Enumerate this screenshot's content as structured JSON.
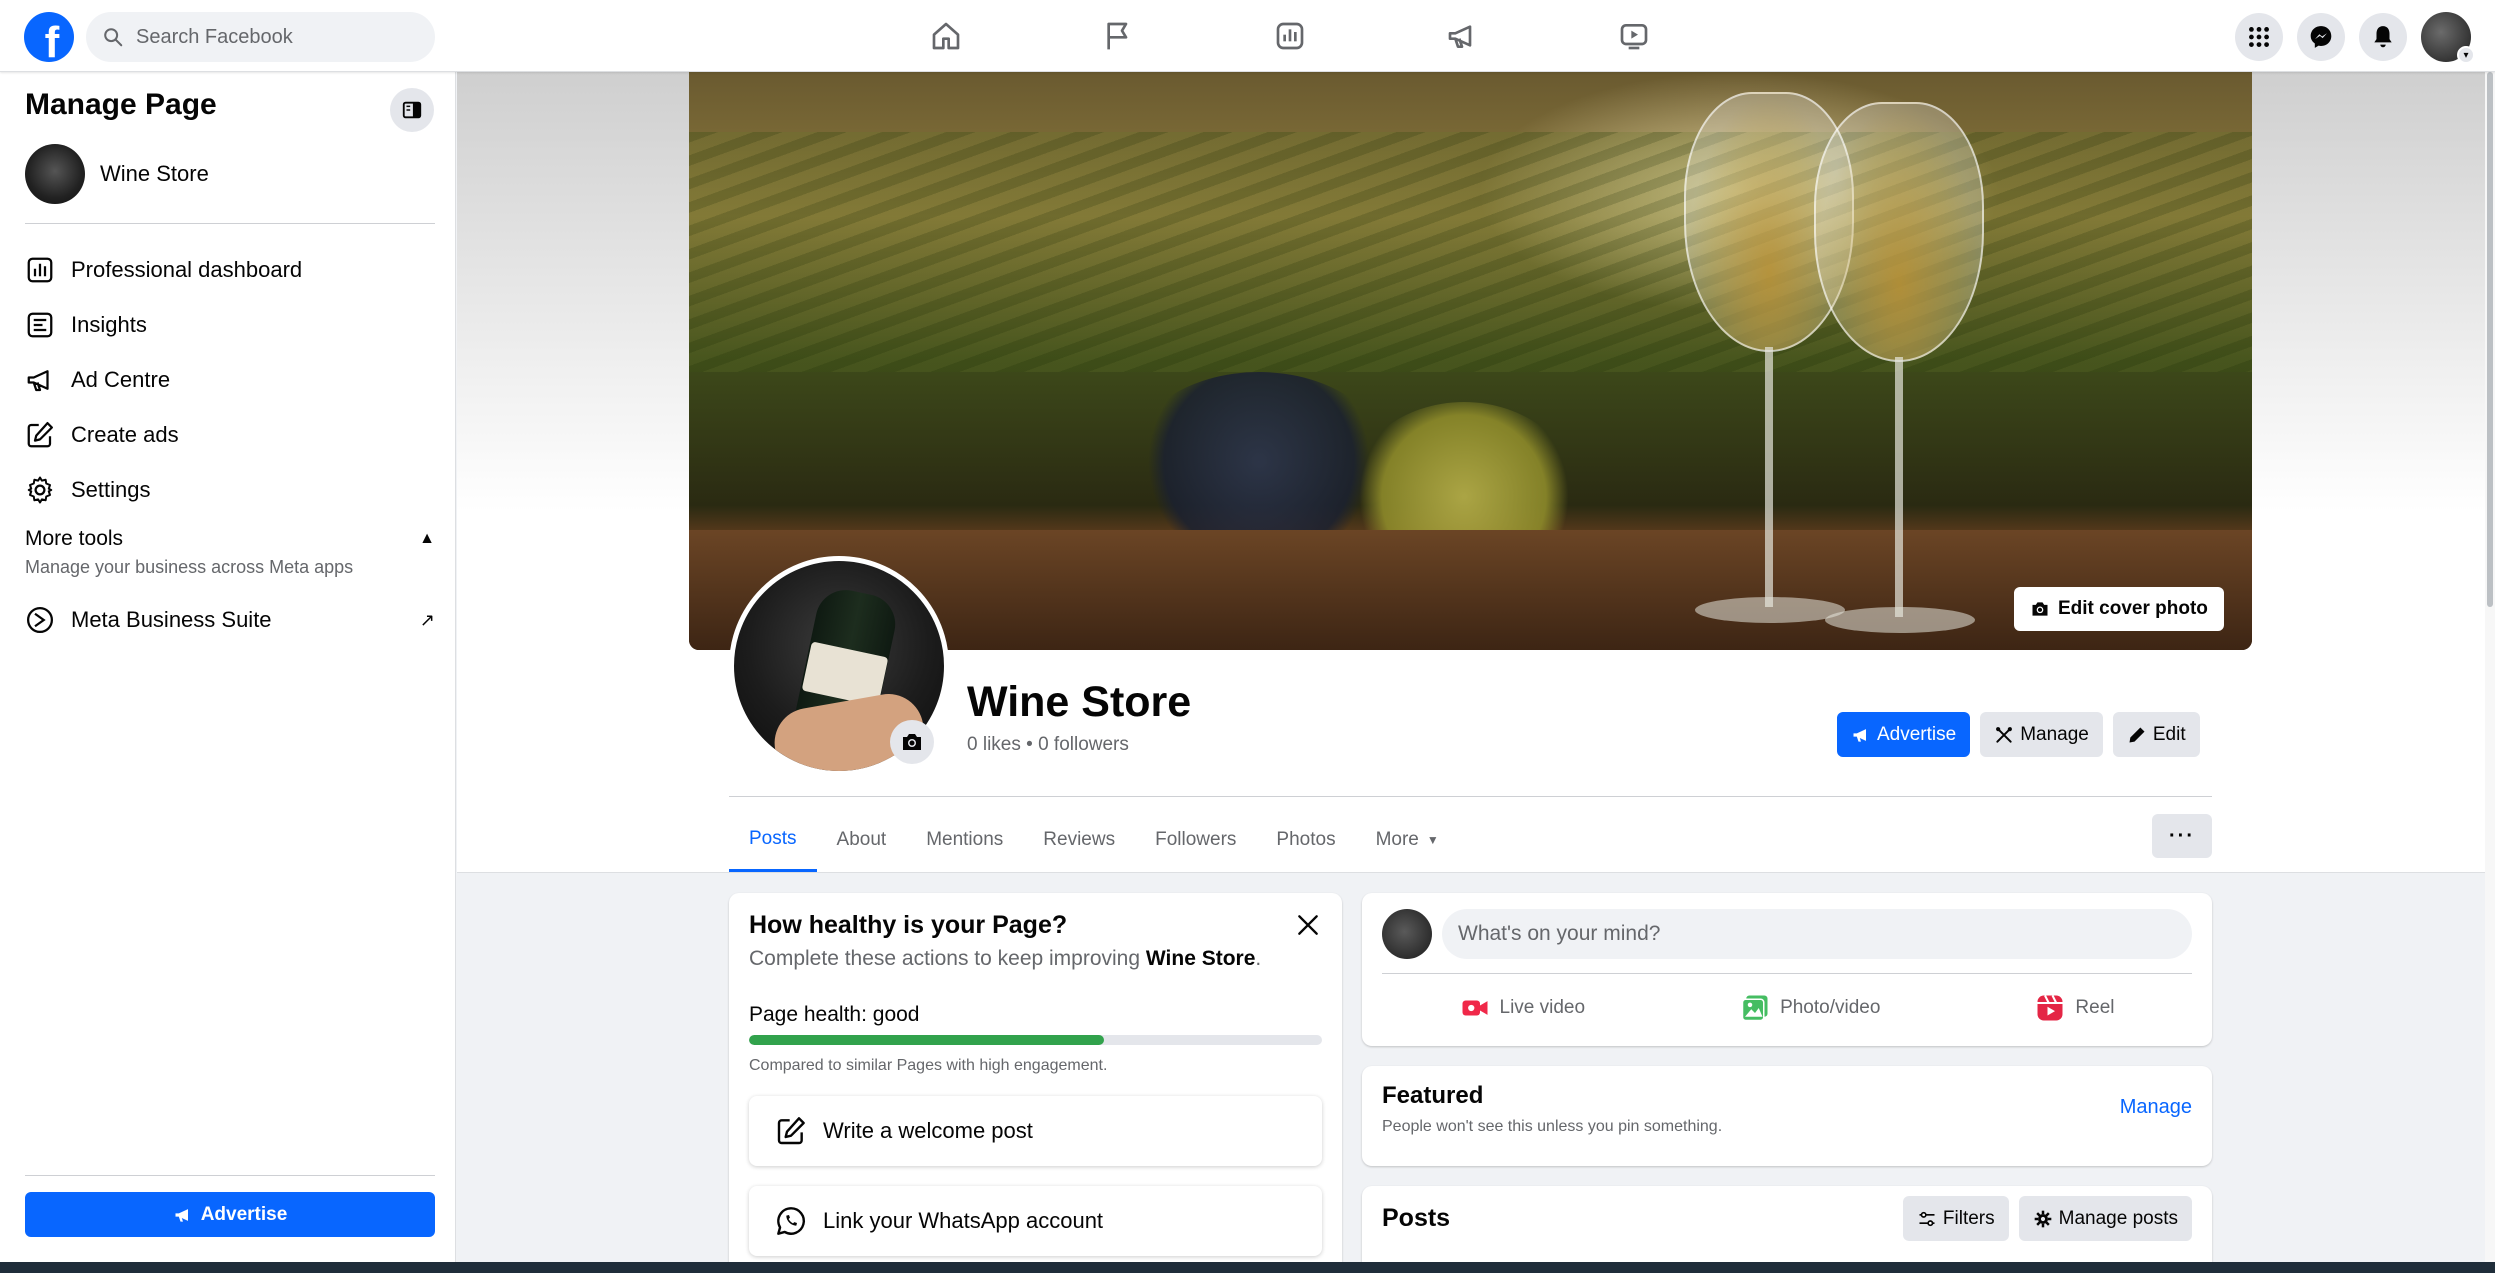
{
  "topbar": {
    "search_placeholder": "Search Facebook",
    "nav_icons": [
      "home-icon",
      "flag-icon",
      "dashboard-icon",
      "megaphone-icon",
      "video-icon"
    ],
    "right_icons": [
      "menu-grid-icon",
      "messenger-icon",
      "bell-icon"
    ]
  },
  "sidebar": {
    "title": "Manage Page",
    "page_name": "Wine Store",
    "items": [
      {
        "label": "Professional dashboard",
        "icon": "dashboard-icon"
      },
      {
        "label": "Insights",
        "icon": "insights-icon"
      },
      {
        "label": "Ad Centre",
        "icon": "megaphone-icon"
      },
      {
        "label": "Create ads",
        "icon": "pencil-square-icon"
      },
      {
        "label": "Settings",
        "icon": "gear-icon"
      }
    ],
    "more_tools": {
      "title": "More tools",
      "subtitle": "Manage your business across Meta apps"
    },
    "meta_business_suite": "Meta Business Suite",
    "advertise_label": "Advertise"
  },
  "header": {
    "edit_cover_label": "Edit cover photo",
    "page_title": "Wine Store",
    "stats": "0 likes • 0 followers",
    "actions": {
      "advertise": "Advertise",
      "manage": "Manage",
      "edit": "Edit"
    },
    "tabs": [
      "Posts",
      "About",
      "Mentions",
      "Reviews",
      "Followers",
      "Photos",
      "More"
    ],
    "active_tab": "Posts",
    "more_dots": "···"
  },
  "health_card": {
    "title": "How healthy is your Page?",
    "subtitle_prefix": "Complete these actions to keep improving ",
    "subtitle_page": "Wine Store",
    "subtitle_suffix": ".",
    "health_label": "Page health: good",
    "health_fraction": 0.62,
    "comparison": "Compared to similar Pages with high engagement.",
    "actions": [
      "Write a welcome post",
      "Link your WhatsApp account"
    ]
  },
  "composer": {
    "placeholder": "What's on your mind?",
    "actions": [
      {
        "label": "Live video",
        "icon": "live-video-icon",
        "color": "#f02849"
      },
      {
        "label": "Photo/video",
        "icon": "photo-icon",
        "color": "#45bd62"
      },
      {
        "label": "Reel",
        "icon": "reel-icon",
        "color": "#e42645"
      }
    ]
  },
  "featured": {
    "title": "Featured",
    "subtitle": "People won't see this unless you pin something.",
    "manage_label": "Manage"
  },
  "posts": {
    "title": "Posts",
    "filters_label": "Filters",
    "manage_posts_label": "Manage posts"
  },
  "colors": {
    "brand_blue": "#0866ff",
    "health_green": "#31a24c",
    "background": "#f0f2f5"
  }
}
